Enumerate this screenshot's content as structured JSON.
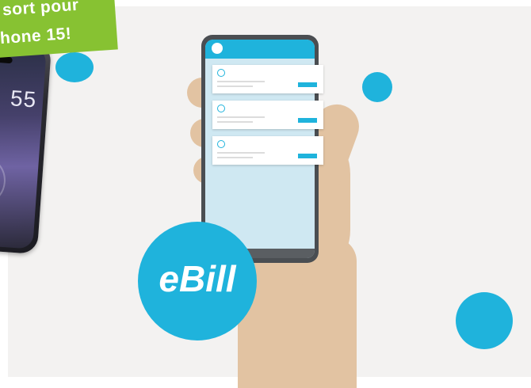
{
  "promo": {
    "line1": "sort pour",
    "line2": "hone 15!",
    "phone_time": "55"
  },
  "logo": {
    "text": "eBill"
  },
  "colors": {
    "accent": "#1fb3dc",
    "promo_green": "#87c232",
    "skin": "#e2c3a2",
    "background": "#f3f2f1"
  },
  "icons": [
    "circle-dot-icon",
    "swirl-icon",
    "coin-icon"
  ]
}
